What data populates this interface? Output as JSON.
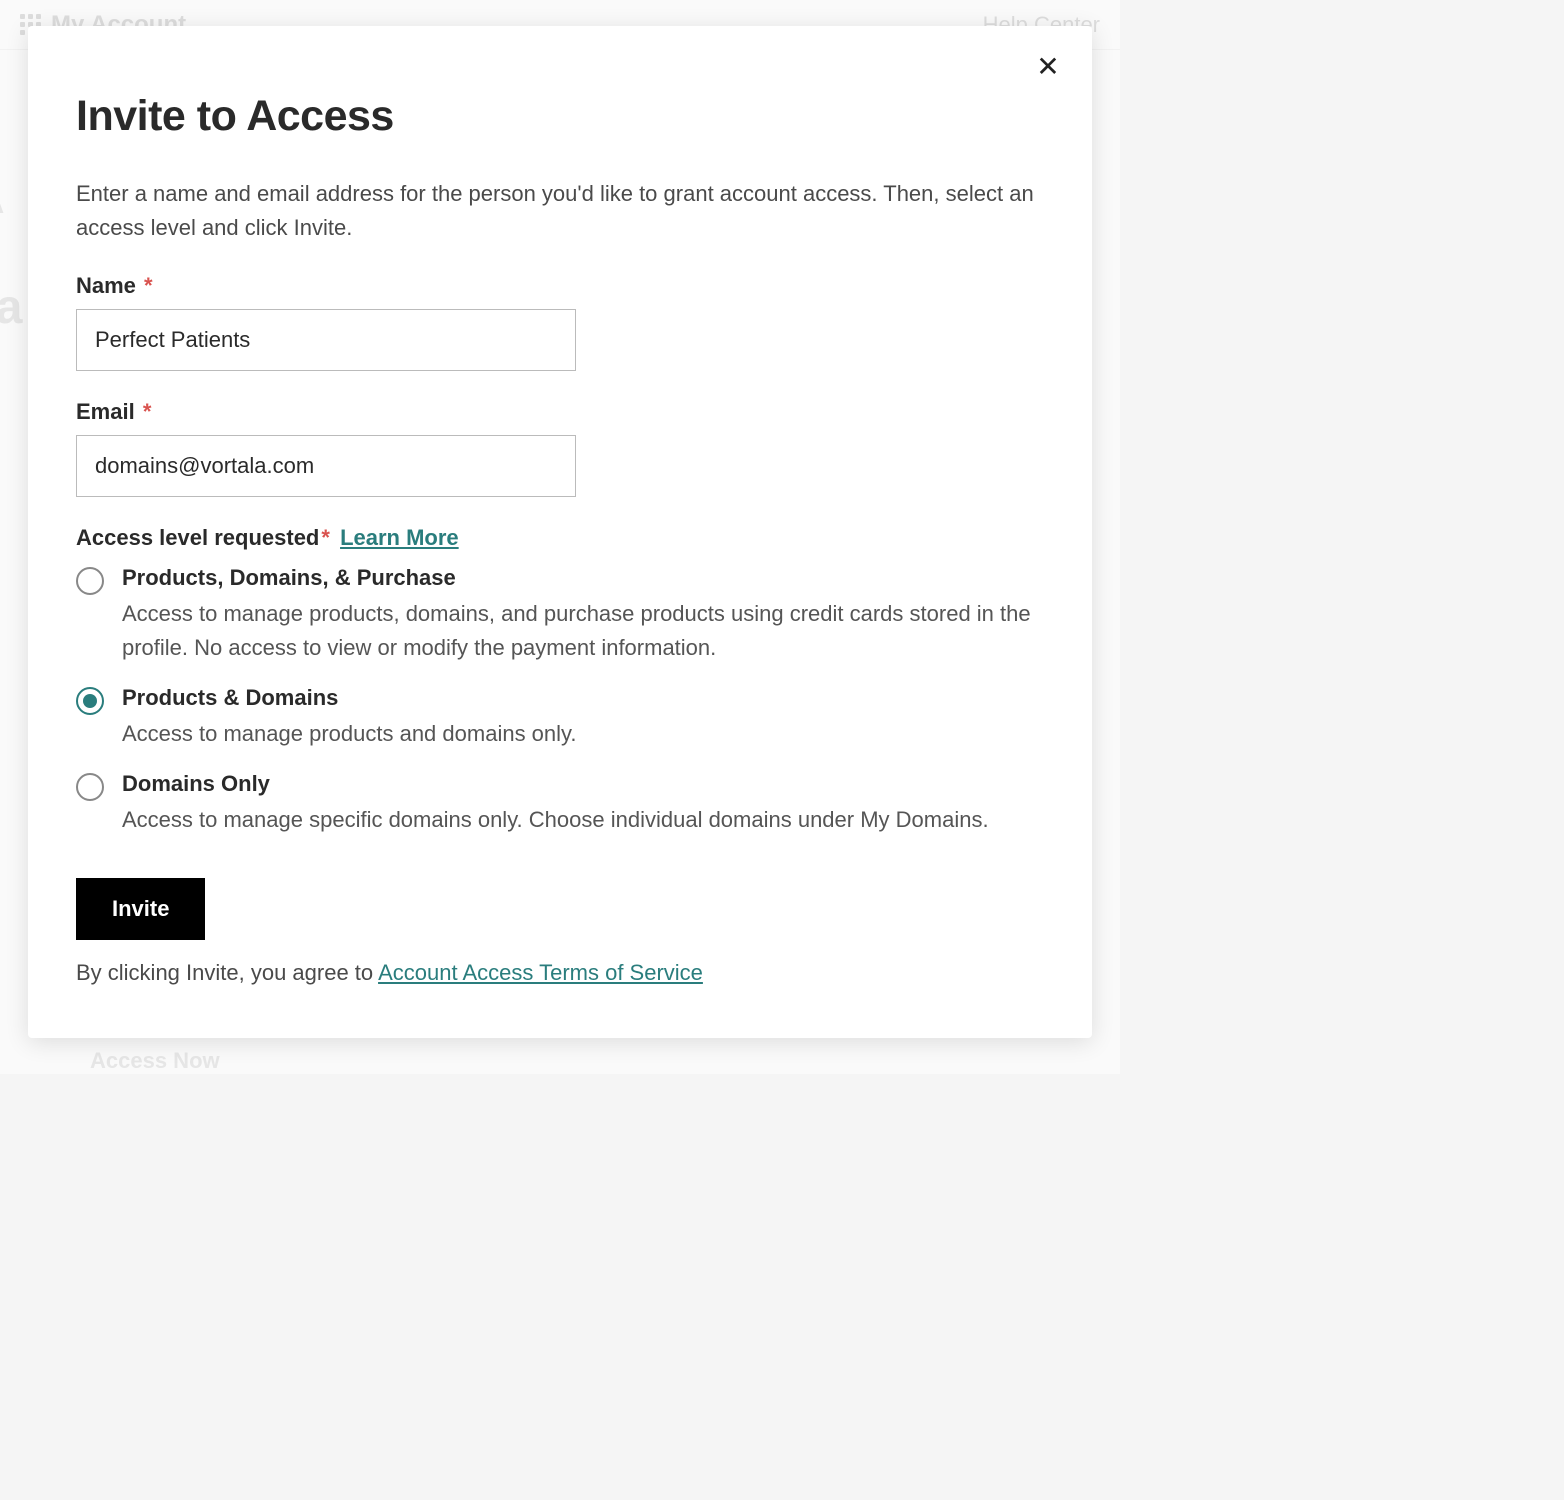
{
  "background": {
    "app_title": "My Account",
    "help_link": "Help Center",
    "side_text_1": "A",
    "side_text_2": "ca",
    "bottom_text": "Access Now"
  },
  "modal": {
    "title": "Invite to Access",
    "description": "Enter a name and email address for the person you'd like to grant account access. Then, select an access level and click Invite.",
    "name_label": "Name",
    "name_value": "Perfect Patients",
    "email_label": "Email",
    "email_value": "domains@vortala.com",
    "access_label": "Access level requested",
    "learn_more": "Learn More",
    "options": [
      {
        "title": "Products, Domains, & Purchase",
        "desc": "Access to manage products, domains, and purchase products using credit cards stored in the profile. No access to view or modify the payment information.",
        "selected": false
      },
      {
        "title": "Products & Domains",
        "desc": "Access to manage products and domains only.",
        "selected": true
      },
      {
        "title": "Domains Only",
        "desc": "Access to manage specific domains only. Choose individual domains under My Domains.",
        "selected": false
      }
    ],
    "invite_button": "Invite",
    "terms_prefix": "By clicking Invite, you agree to ",
    "terms_link": "Account Access Terms of Service"
  }
}
